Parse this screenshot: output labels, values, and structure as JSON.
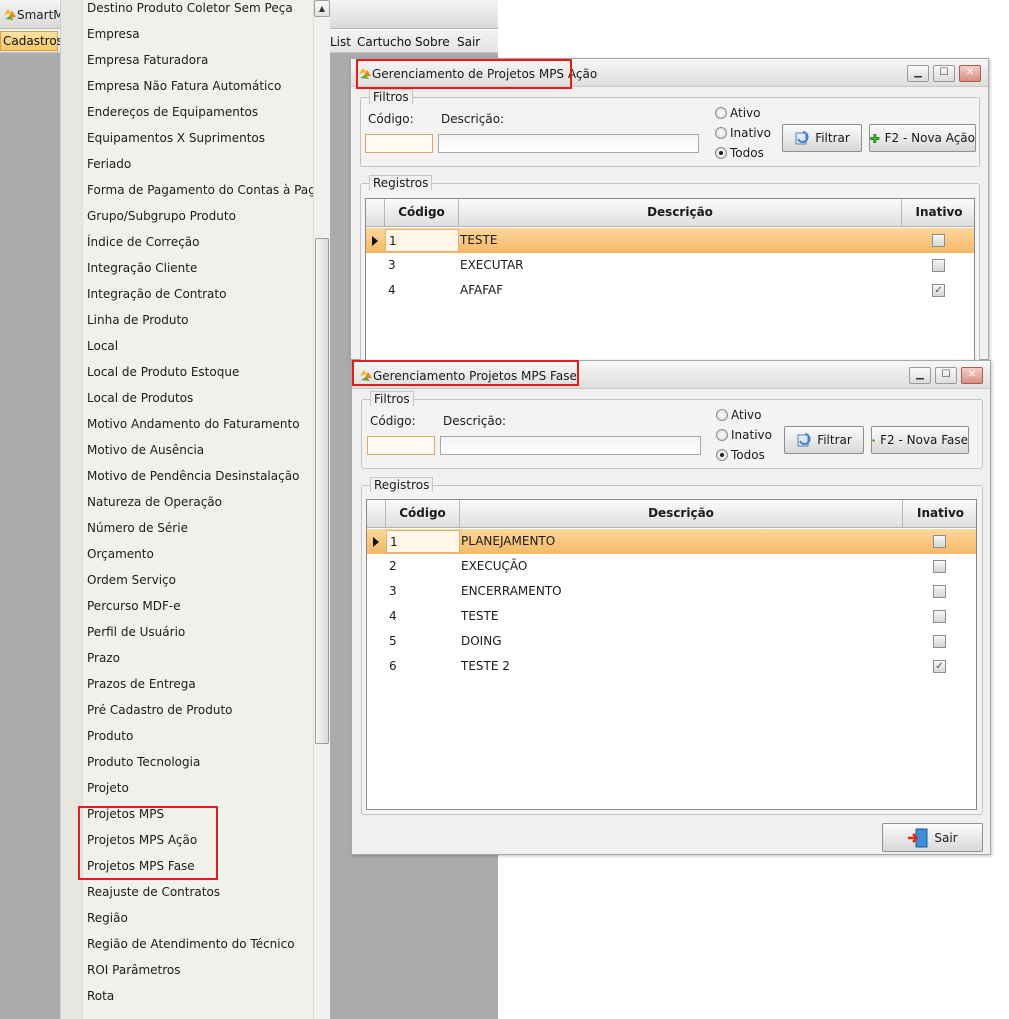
{
  "app": {
    "title": "SmartMa",
    "menu": {
      "active": "Cadastros",
      "items": [
        "List",
        "Cartucho",
        "Sobre",
        "Sair"
      ]
    }
  },
  "dropdown": {
    "items": [
      "Destino Produto Coletor Sem Peça",
      "Empresa",
      "Empresa Faturadora",
      "Empresa Não Fatura Automático",
      "Endereços de Equipamentos",
      "Equipamentos X Suprimentos",
      "Feriado",
      "Forma de Pagamento do Contas à Pagar",
      "Grupo/Subgrupo Produto",
      "Índice de Correção",
      "Integração Cliente",
      "Integração de Contrato",
      "Linha de Produto",
      "Local",
      "Local de Produto Estoque",
      "Local de Produtos",
      "Motivo Andamento do Faturamento",
      "Motivo de Ausência",
      "Motivo de Pendência Desinstalação",
      "Natureza de Operação",
      "Número de Série",
      "Orçamento",
      "Ordem Serviço",
      "Percurso MDF-e",
      "Perfil de Usuário",
      "Prazo",
      "Prazos de Entrega",
      "Pré Cadastro de Produto",
      "Produto",
      "Produto Tecnologia",
      "Projeto",
      "Projetos MPS",
      "Projetos MPS Ação",
      "Projetos MPS Fase",
      "Reajuste de Contratos",
      "Região",
      "Região de Atendimento do Técnico",
      "ROI Parâmetros",
      "Rota"
    ],
    "scroll_up": "▲"
  },
  "acao": {
    "title": "Gerenciamento de Projetos MPS Ação",
    "filters_label": "Filtros",
    "codigo_label": "Código:",
    "descricao_label": "Descrição:",
    "radio": {
      "ativo": "Ativo",
      "inativo": "Inativo",
      "todos": "Todos",
      "selected": "todos"
    },
    "filtrar_label": "Filtrar",
    "nova_label": "F2 - Nova Ação",
    "records_label": "Registros",
    "headers": {
      "codigo": "Código",
      "descricao": "Descrição",
      "inativo": "Inativo"
    },
    "rows": [
      {
        "codigo": "1",
        "descricao": "TESTE",
        "inativo": false
      },
      {
        "codigo": "3",
        "descricao": "EXECUTAR",
        "inativo": false
      },
      {
        "codigo": "4",
        "descricao": "AFAFAF",
        "inativo": true
      }
    ]
  },
  "fase": {
    "title": "Gerenciamento Projetos MPS Fase",
    "filters_label": "Filtros",
    "codigo_label": "Código:",
    "descricao_label": "Descrição:",
    "radio": {
      "ativo": "Ativo",
      "inativo": "Inativo",
      "todos": "Todos",
      "selected": "todos"
    },
    "filtrar_label": "Filtrar",
    "nova_label": "F2 - Nova Fase",
    "records_label": "Registros",
    "headers": {
      "codigo": "Código",
      "descricao": "Descrição",
      "inativo": "Inativo"
    },
    "rows": [
      {
        "codigo": "1",
        "descricao": "PLANEJAMENTO",
        "inativo": false
      },
      {
        "codigo": "2",
        "descricao": "EXECUÇÃO",
        "inativo": false
      },
      {
        "codigo": "3",
        "descricao": "ENCERRAMENTO",
        "inativo": false
      },
      {
        "codigo": "4",
        "descricao": "TESTE",
        "inativo": false
      },
      {
        "codigo": "5",
        "descricao": "DOING",
        "inativo": false
      },
      {
        "codigo": "6",
        "descricao": "TESTE 2",
        "inativo": true
      }
    ],
    "sair_label": "Sair"
  },
  "icons": {
    "app_logo": "smartmanager-logo-icon",
    "filter": "filter-refresh-icon",
    "add": "green-plus-icon",
    "exit": "exit-door-icon",
    "minimize": "minimize-icon",
    "maximize": "maximize-icon",
    "close": "close-icon"
  },
  "colors": {
    "highlight": "#e31b1b",
    "selected_row": "#f7c070",
    "menu_active": "#f7c96a"
  }
}
